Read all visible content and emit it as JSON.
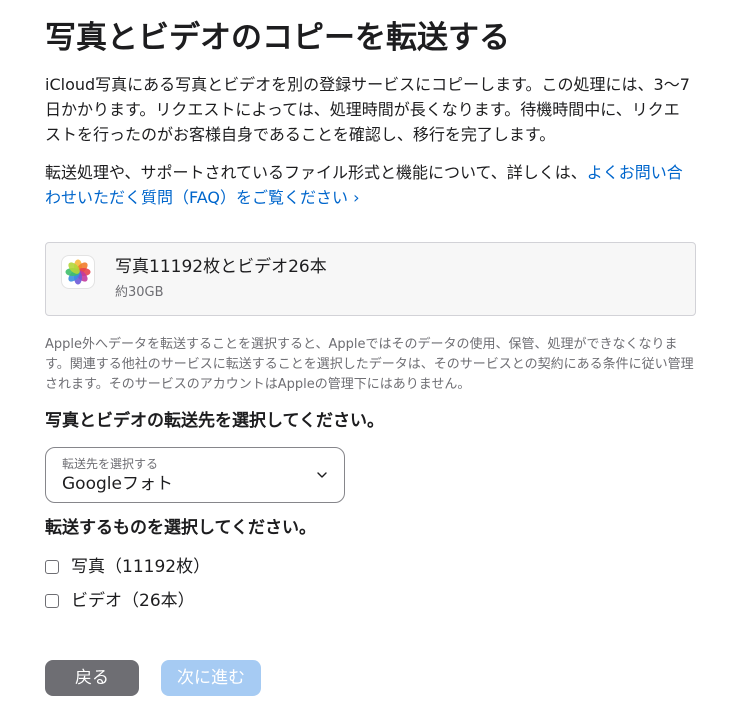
{
  "page": {
    "title": "写真とビデオのコピーを転送する",
    "intro": "iCloud写真にある写真とビデオを別の登録サービスにコピーします。この処理には、3〜7日かかります。リクエストによっては、処理時間が長くなります。待機時間中に、リクエストを行ったのがお客様自身であることを確認し、移行を完了します。",
    "support_text": "転送処理や、サポートされているファイル形式と機能について、詳しくは、",
    "support_link": "よくお問い合わせいただく質問（FAQ）をご覧ください ›"
  },
  "summary": {
    "icon": "photos-app-icon",
    "title": "写真11192枚とビデオ26本",
    "size": "約30GB"
  },
  "disclaimer": "Apple外へデータを転送することを選択すると、Appleではそのデータの使用、保管、処理ができなくなります。関連する他社のサービスに転送することを選択したデータは、そのサービスとの契約にある条件に従い管理されます。そのサービスのアカウントはAppleの管理下にはありません。",
  "destination": {
    "heading": "写真とビデオの転送先を選択してください。",
    "select_label": "転送先を選択する",
    "select_value": "Googleフォト"
  },
  "content_choice": {
    "heading": "転送するものを選択してください。",
    "options": [
      {
        "label": "写真（11192枚）",
        "checked": false
      },
      {
        "label": "ビデオ（26本）",
        "checked": false
      }
    ]
  },
  "buttons": {
    "back": "戻る",
    "next": "次に進む",
    "next_enabled": false
  },
  "colors": {
    "link": "#0066cc",
    "back_button": "#6e6e73",
    "next_button_disabled": "#a6cbf3",
    "secondary_text": "#6e6e73"
  }
}
